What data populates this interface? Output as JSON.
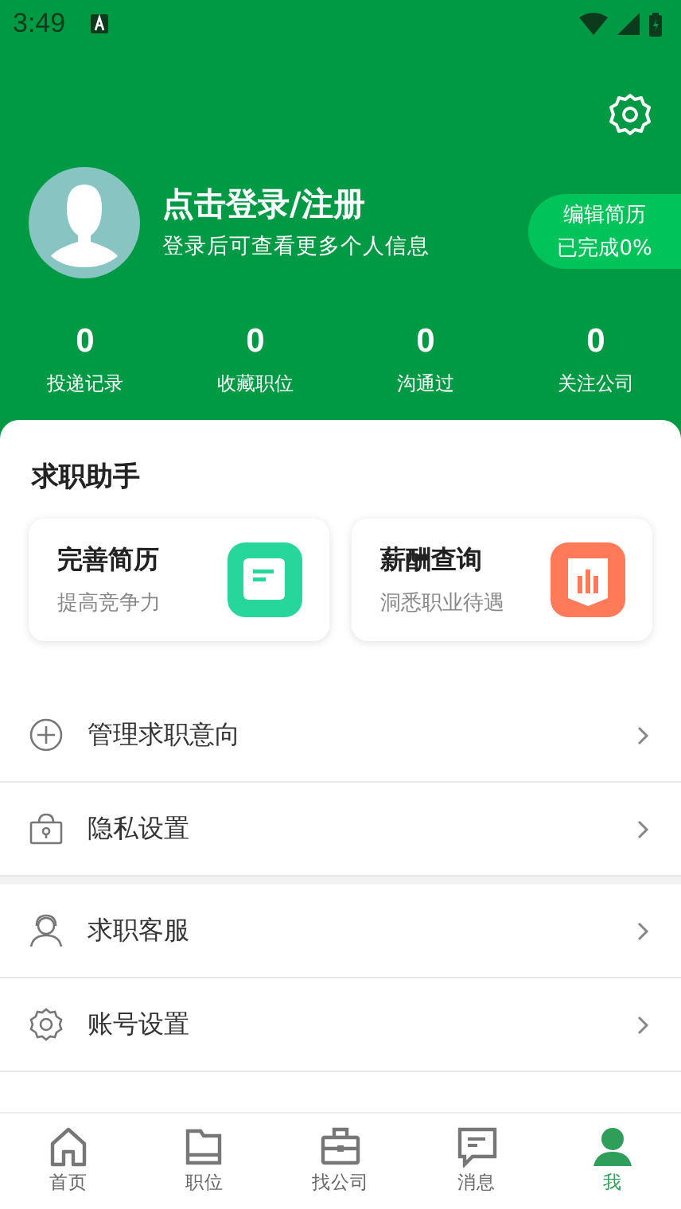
{
  "status_bar": {
    "time": "3:49"
  },
  "profile": {
    "title": "点击登录/注册",
    "subtitle": "登录后可查看更多个人信息",
    "resume_button": {
      "line1": "编辑简历",
      "line2": "已完成0%"
    }
  },
  "stats": [
    {
      "value": "0",
      "label": "投递记录"
    },
    {
      "value": "0",
      "label": "收藏职位"
    },
    {
      "value": "0",
      "label": "沟通过"
    },
    {
      "value": "0",
      "label": "关注公司"
    }
  ],
  "assistant": {
    "title": "求职助手",
    "cards": [
      {
        "title": "完善简历",
        "subtitle": "提高竞争力",
        "color": "#26d69a"
      },
      {
        "title": "薪酬查询",
        "subtitle": "洞悉职业待遇",
        "color": "#fe7a58"
      }
    ]
  },
  "menu_groups": [
    [
      {
        "label": "管理求职意向"
      },
      {
        "label": "隐私设置"
      }
    ],
    [
      {
        "label": "求职客服"
      },
      {
        "label": "账号设置"
      }
    ]
  ],
  "tab_bar": [
    {
      "label": "首页",
      "selected": false
    },
    {
      "label": "职位",
      "selected": false
    },
    {
      "label": "找公司",
      "selected": false
    },
    {
      "label": "消息",
      "selected": false
    },
    {
      "label": "我",
      "selected": true
    }
  ]
}
